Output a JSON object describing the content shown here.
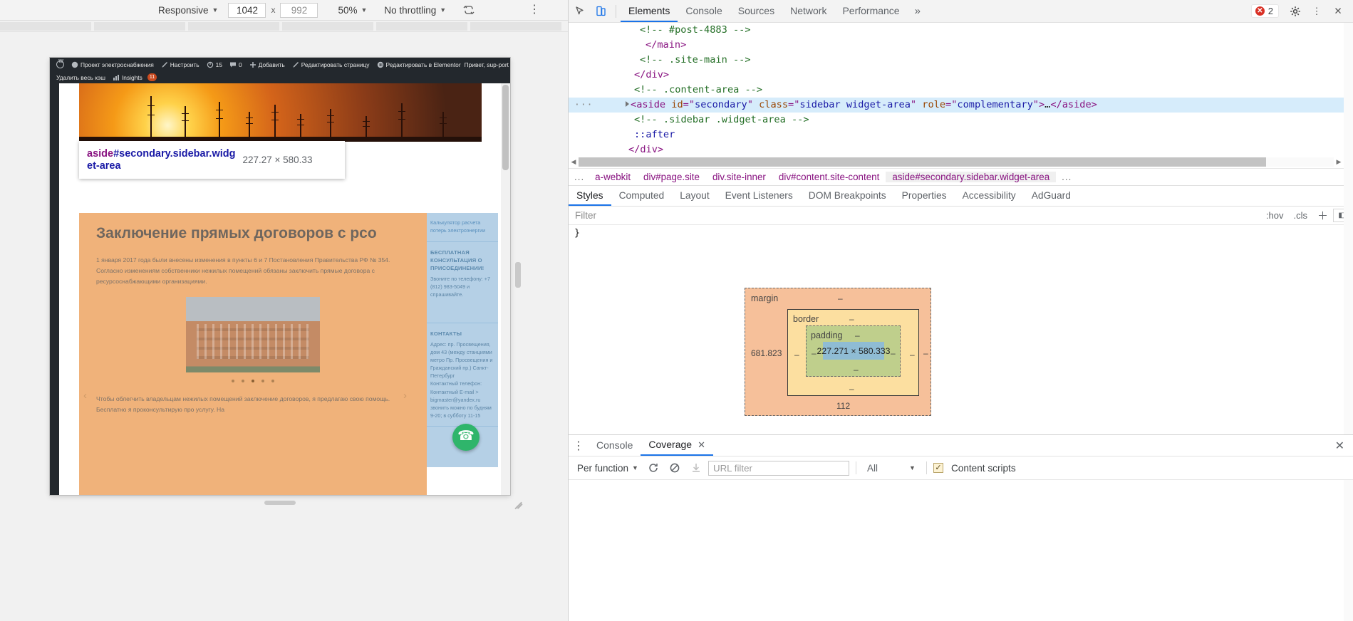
{
  "device_toolbar": {
    "device": "Responsive",
    "width": "1042",
    "height": "992",
    "height_placeholder": "992",
    "zoom": "50%",
    "throttling": "No throttling",
    "rotate_icon": "rotate-icon",
    "more_icon": "kebab-menu-icon",
    "x_separator": "x"
  },
  "page_preview": {
    "adminbar": {
      "logo_icon": "wordpress-logo-icon",
      "items": [
        {
          "icon": "home-icon",
          "label": "Проект электроснабжения"
        },
        {
          "icon": "pencil-icon",
          "label": "Настроить"
        },
        {
          "icon": "refresh-icon",
          "label": "15"
        },
        {
          "icon": "comment-icon",
          "label": "0"
        },
        {
          "icon": "plus-icon",
          "label": "Добавить"
        },
        {
          "icon": "edit-icon",
          "label": "Редактировать страницу"
        },
        {
          "icon": "elementor-icon",
          "label": "Редактировать в Elementor"
        }
      ],
      "greeting": "Привет, sup-port",
      "search_icon": "search-icon",
      "avatar": "avatar"
    },
    "adminbar_row2": {
      "cache_label": "Удалить весь кэш",
      "insights_icon": "bar-chart-icon",
      "insights_label": "Insights",
      "insights_badge": "11"
    },
    "inspector_tooltip": {
      "tag": "aside",
      "id": "#secondary",
      "classes": ".sidebar.widg\net-area",
      "full_selector": "aside#secondary.sidebar.widget-area",
      "dimensions": "227.27 × 580.33"
    },
    "article": {
      "title": "Заключение прямых договоров с рсо",
      "paragraph1": "1 января 2017 года были внесены изменения в пункты 6 и 7 Постановления Правительства РФ № 354. Согласно изменениям собственники нежилых помещений обязаны заключить прямые договора с ресурсоснабжающими организациями.",
      "paragraph2": "Чтобы облегчить владельцам нежилых помещений заключение договоров, я предлагаю свою помощь. Бесплатно я проконсультирую про услугу. На"
    },
    "sidebar_widgets": [
      {
        "title": "Калькулятор расчета потерь электроэнергии",
        "type": "link"
      },
      {
        "title": "БЕСПЛАТНАЯ КОНСУЛЬТАЦИЯ О ПРИСОЕДИНЕНИИ!",
        "body": "Звоните по телефону: +7 (812) 983-5049 и спрашивайте."
      },
      {
        "title": "КОНТАКТЫ",
        "body": "Адрес: пр. Просвещения, дом 43 (между станциями метро Пр. Просвещения и Гражданский пр.) Санкт-Петербург\nКонтактный телефон:\nКонтактный E-mail >\nbigmaster@yandex.ru\nзвонить можно по будням 9-20; в субботу 11-15"
      }
    ],
    "phone_button_icon": "phone-icon"
  },
  "devtools": {
    "toolbar": {
      "inspect_icon": "inspect-element-icon",
      "device_toggle_icon": "device-toolbar-icon",
      "tabs": [
        "Elements",
        "Console",
        "Sources",
        "Network",
        "Performance"
      ],
      "selected_tab": "Elements",
      "overflow_icon": "more-tabs-chevrons-icon",
      "error_badge_icon": "error-icon",
      "error_count": "2",
      "settings_icon": "gear-icon",
      "more_icon": "kebab-menu-icon",
      "close_icon": "close-icon"
    },
    "dom_tree": {
      "lines": [
        {
          "indent": 4,
          "type": "comment",
          "text": "<!-- #post-4883 -->"
        },
        {
          "indent": 4,
          "type": "tag",
          "text": "</main>"
        },
        {
          "indent": 4,
          "type": "comment",
          "text": "<!-- .site-main -->"
        },
        {
          "indent": 3,
          "type": "tag",
          "text": "</div>"
        },
        {
          "indent": 3,
          "type": "comment",
          "text": "<!-- .content-area -->"
        },
        {
          "indent": 3,
          "type": "selected",
          "text": "<aside id=\"secondary\" class=\"sidebar widget-area\" role=\"complementary\">…</aside>"
        },
        {
          "indent": 3,
          "type": "comment",
          "text": "<!-- .sidebar .widget-area -->"
        },
        {
          "indent": 3,
          "type": "pseudo",
          "text": "::after"
        },
        {
          "indent": 2,
          "type": "tag",
          "text": "</div>"
        }
      ],
      "selected_attrs": {
        "tag": "aside",
        "id_attr": "id",
        "id_value": "secondary",
        "class_attr": "class",
        "class_value": "sidebar widget-area",
        "role_attr": "role",
        "role_value": "complementary",
        "ellipsis": "…",
        "close_tag": "</aside>"
      },
      "gutter_dots": "···"
    },
    "breadcrumb": {
      "overflow": "...",
      "items": [
        "a-webkit",
        "div#page.site",
        "div.site-inner",
        "div#content.site-content",
        "aside#secondary.sidebar.widget-area"
      ],
      "selected": "aside#secondary.sidebar.widget-area",
      "trailing_overflow": "..."
    },
    "sidebar_tabs": {
      "tabs": [
        "Styles",
        "Computed",
        "Layout",
        "Event Listeners",
        "DOM Breakpoints",
        "Properties",
        "Accessibility",
        "AdGuard"
      ],
      "selected": "Styles"
    },
    "filter_bar": {
      "placeholder": "Filter",
      "hov": ":hov",
      "cls": ".cls",
      "new_rule_icon": "plus-icon",
      "toggle_panel_icon": "toggle-sidebar-icon"
    },
    "rules": {
      "text": "}"
    },
    "box_model": {
      "margin_label": "margin",
      "border_label": "border",
      "padding_label": "padding",
      "content_size": "227.271 × 580.333",
      "margin_top": "–",
      "margin_right": "–",
      "margin_bottom": "112",
      "margin_left": "681.823",
      "border_top": "–",
      "border_right": "–",
      "border_bottom": "–",
      "border_left": "–",
      "padding_top": "–",
      "padding_right": "–",
      "padding_bottom": "–",
      "padding_left": "–"
    },
    "drawer": {
      "more_icon": "kebab-menu-icon",
      "tabs": [
        "Console",
        "Coverage"
      ],
      "selected_tab": "Coverage",
      "tab_close_icon": "close-icon",
      "drawer_close_icon": "close-icon",
      "toolbar": {
        "mode": "Per function",
        "reload_icon": "reload-icon",
        "clear_icon": "clear-icon",
        "export_icon": "download-icon",
        "url_filter_placeholder": "URL filter",
        "type_filter": "All",
        "content_scripts_label": "Content scripts",
        "content_scripts_checked": true
      }
    }
  }
}
